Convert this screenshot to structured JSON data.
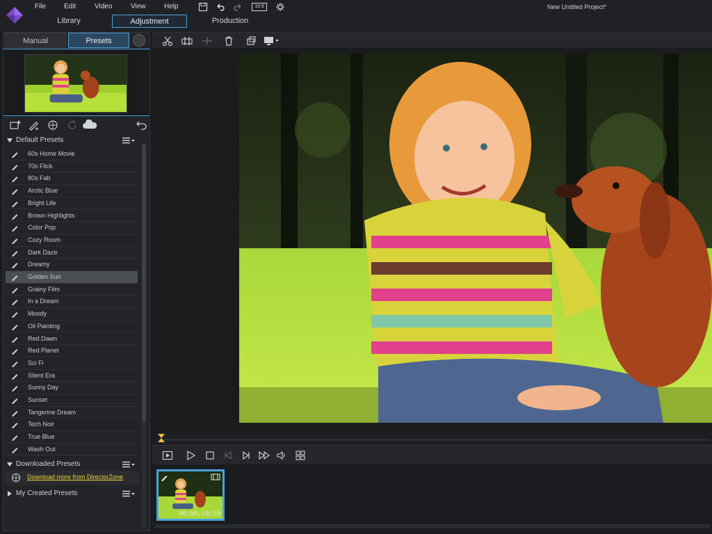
{
  "menu": [
    "File",
    "Edit",
    "Video",
    "View",
    "Help"
  ],
  "modes": {
    "library": "Library",
    "adjustment": "Adjustment",
    "production": "Production"
  },
  "project_title": "New Untitled Project*",
  "aspect_label": "16:9",
  "panel_tabs": {
    "manual": "Manual",
    "presets": "Presets"
  },
  "sections": {
    "default": "Default Presets",
    "downloaded": "Downloaded Presets",
    "created": "My Created Presets"
  },
  "presets": [
    "60s Home Movie",
    "70s Flick",
    "80s Fab",
    "Arctic Blue",
    "Bright Life",
    "Brown Highlights",
    "Color Pop",
    "Cozy Room",
    "Dark Daze",
    "Dreamy",
    "Golden Sun",
    "Grainy Film",
    "In a Dream",
    "Moody",
    "Oil Painting",
    "Red Dawn",
    "Red Planet",
    "Sci Fi",
    "Silent Era",
    "Sunny Day",
    "Sunset",
    "Tangerine Dream",
    "Tech Noir",
    "True Blue",
    "Wash Out"
  ],
  "selected_preset": "Golden Sun",
  "download_link": "Download more from DirectorZone",
  "clip_time": "00;00;19;29",
  "colors": {
    "accent": "#4aa3e0",
    "link": "#f0d238",
    "playhead": "#f0c040"
  }
}
